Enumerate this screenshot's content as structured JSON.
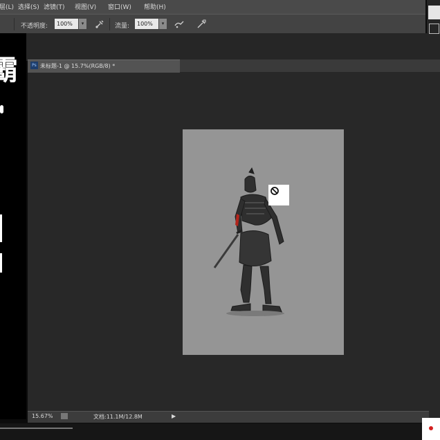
{
  "menubar": {
    "items": [
      "图层(L)",
      "选择(S)",
      "滤镜(T)",
      "视图(V)",
      "窗口(W)",
      "帮助(H)"
    ]
  },
  "options": {
    "opacity_label": "不透明度:",
    "opacity_value": "100%",
    "flow_label": "流量:",
    "flow_value": "100%"
  },
  "overlay": {
    "caption_char": "霸"
  },
  "document": {
    "tab_title": "未标题-1 @ 15.7%(RGB/8) *",
    "ps_badge": "Ps"
  },
  "status": {
    "zoom": "15.67%",
    "doc_size": "文档:11.1M/12.8M",
    "arrow": "▶"
  },
  "colors": {
    "canvas": "#959595",
    "workspace": "#282828",
    "accent_swatch": "#e27e16"
  },
  "icons": [
    "brush-pressure-icon",
    "airbrush-icon",
    "tablet-size-icon",
    "no-entry-cursor-icon"
  ]
}
